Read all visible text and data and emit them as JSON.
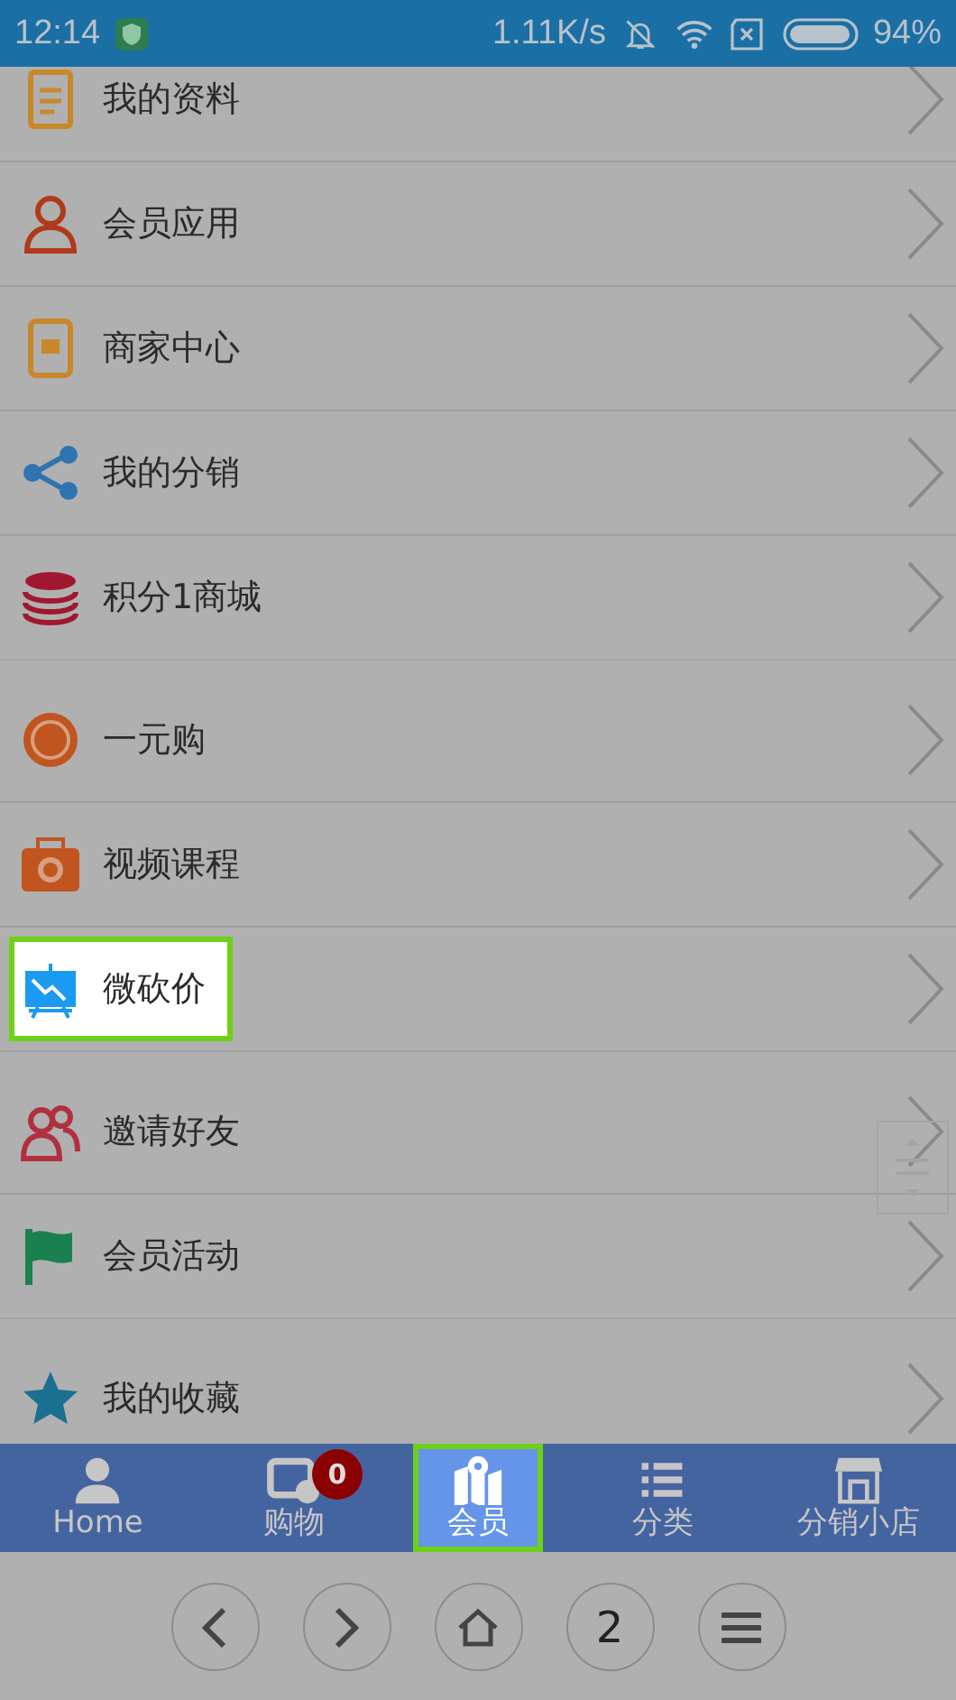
{
  "status_bar": {
    "time": "12:14",
    "speed": "1.11K/s",
    "battery": "94%"
  },
  "sections": [
    {
      "items": [
        {
          "label": "我的资料",
          "kind": "doc",
          "highlighted": false
        },
        {
          "label": "会员应用",
          "kind": "person",
          "highlighted": false
        },
        {
          "label": "商家中心",
          "kind": "tablet",
          "highlighted": false
        },
        {
          "label": "我的分销",
          "kind": "share",
          "highlighted": false
        },
        {
          "label": "积分1商城",
          "kind": "coins",
          "highlighted": false
        }
      ]
    },
    {
      "items": [
        {
          "label": "一元购",
          "kind": "ring",
          "highlighted": false
        },
        {
          "label": "视频课程",
          "kind": "camera",
          "highlighted": false
        },
        {
          "label": "微砍价",
          "kind": "board",
          "highlighted": true
        }
      ]
    },
    {
      "items": [
        {
          "label": "邀请好友",
          "kind": "people",
          "highlighted": false
        },
        {
          "label": "会员活动",
          "kind": "flag",
          "highlighted": false
        }
      ]
    },
    {
      "items": [
        {
          "label": "我的收藏",
          "kind": "star",
          "highlighted": false
        }
      ]
    }
  ],
  "tabs": [
    {
      "label": "Home",
      "kind": "user",
      "selected": false
    },
    {
      "label": "购物",
      "kind": "cart",
      "selected": false,
      "badge": "0"
    },
    {
      "label": "会员",
      "kind": "map",
      "selected": true
    },
    {
      "label": "分类",
      "kind": "list",
      "selected": false
    },
    {
      "label": "分销小店",
      "kind": "shop",
      "selected": false
    }
  ],
  "browser_buttons": [
    {
      "kind": "back"
    },
    {
      "kind": "forward"
    },
    {
      "kind": "home"
    },
    {
      "kind": "pages",
      "label": "2"
    },
    {
      "kind": "menu"
    }
  ]
}
